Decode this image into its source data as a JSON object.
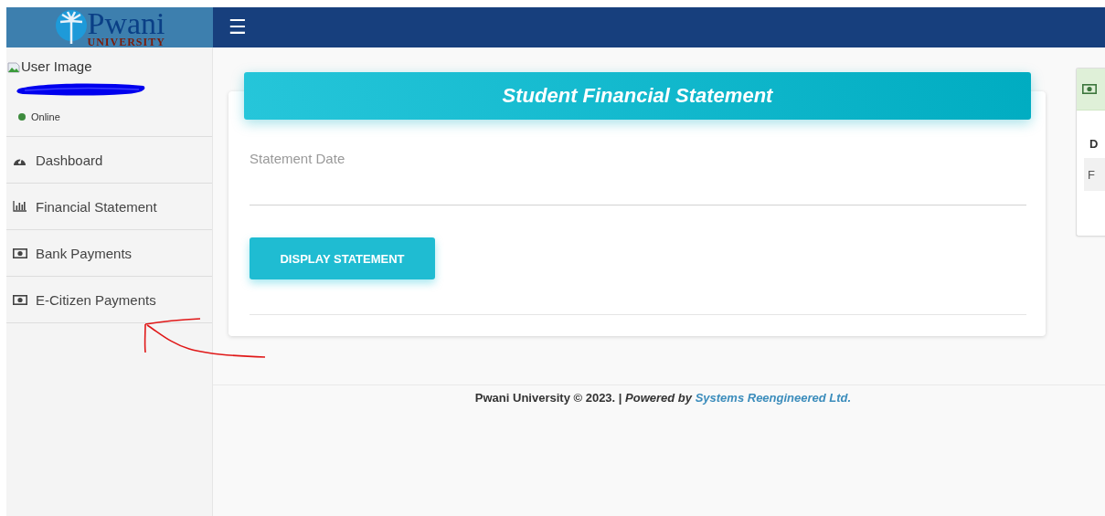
{
  "header": {
    "logo_name": "Pwani",
    "logo_sub": "UNIVERSITY",
    "menu_icon": "☰"
  },
  "user_panel": {
    "image_alt": "User Image",
    "status": "Online",
    "online": true
  },
  "sidebar": {
    "items": [
      {
        "label": "Dashboard",
        "kind": "dashboard",
        "selected": false
      },
      {
        "label": "Financial Statement",
        "kind": "chart",
        "selected": false
      },
      {
        "label": "Bank Payments",
        "kind": "money",
        "selected": false
      },
      {
        "label": "E-Citizen Payments",
        "kind": "money",
        "selected": false
      }
    ]
  },
  "statement_card": {
    "title": "Student Financial Statement",
    "date_field": {
      "placeholder": "Statement Date"
    },
    "button": "DISPLAY STATEMENT"
  },
  "side_card": {
    "column_1": "D",
    "row_1": "F"
  },
  "footer": {
    "text": "Pwani University © 2023. | *Powered by*",
    "link": "Systems Reengineered Ltd."
  },
  "annotations": {
    "redaction_scribble": true,
    "arrow": true
  }
}
